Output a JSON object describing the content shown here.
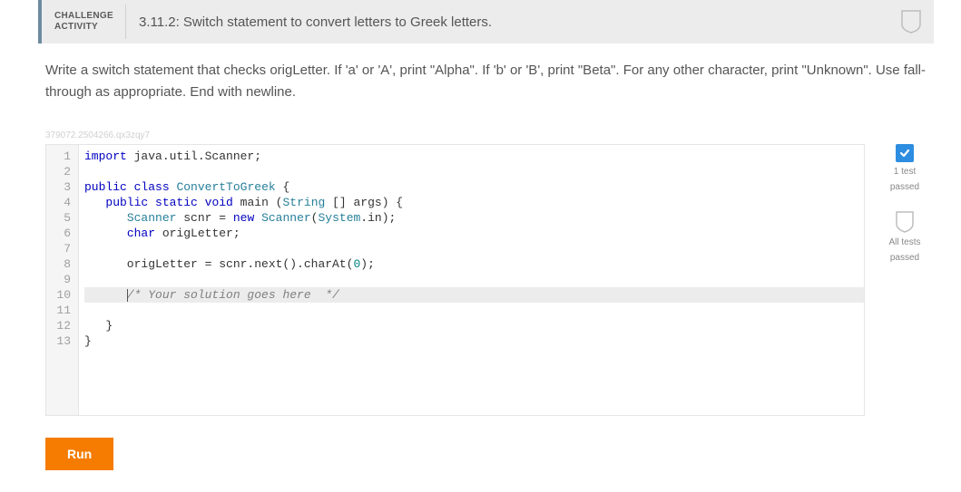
{
  "header": {
    "label_line1": "CHALLENGE",
    "label_line2": "ACTIVITY",
    "title": "3.11.2: Switch statement to convert letters to Greek letters."
  },
  "prompt": "Write a switch statement that checks origLetter. If 'a' or 'A', print \"Alpha\". If 'b' or 'B', print \"Beta\". For any other character, print \"Unknown\". Use fall-through as appropriate. End with newline.",
  "watermark": "379072.2504266.qx3zqy7",
  "code": {
    "line_numbers": [
      "1",
      "2",
      "3",
      "4",
      "5",
      "6",
      "7",
      "8",
      "9",
      "10",
      "11",
      "12",
      "13"
    ],
    "lines": [
      {
        "i": 1,
        "segs": [
          {
            "t": "import",
            "c": "kw"
          },
          {
            "t": " java.util.Scanner;",
            "c": ""
          }
        ]
      },
      {
        "i": 2,
        "segs": []
      },
      {
        "i": 3,
        "segs": [
          {
            "t": "public",
            "c": "kw"
          },
          {
            "t": " ",
            "c": ""
          },
          {
            "t": "class",
            "c": "kw"
          },
          {
            "t": " ",
            "c": ""
          },
          {
            "t": "ConvertToGreek",
            "c": "cls"
          },
          {
            "t": " {",
            "c": ""
          }
        ]
      },
      {
        "i": 4,
        "segs": [
          {
            "t": "   ",
            "c": ""
          },
          {
            "t": "public",
            "c": "kw"
          },
          {
            "t": " ",
            "c": ""
          },
          {
            "t": "static",
            "c": "kw"
          },
          {
            "t": " ",
            "c": ""
          },
          {
            "t": "void",
            "c": "kw"
          },
          {
            "t": " main (",
            "c": ""
          },
          {
            "t": "String",
            "c": "type"
          },
          {
            "t": " [] args) {",
            "c": ""
          }
        ]
      },
      {
        "i": 5,
        "segs": [
          {
            "t": "      ",
            "c": ""
          },
          {
            "t": "Scanner",
            "c": "type"
          },
          {
            "t": " scnr = ",
            "c": ""
          },
          {
            "t": "new",
            "c": "kw"
          },
          {
            "t": " ",
            "c": ""
          },
          {
            "t": "Scanner",
            "c": "type"
          },
          {
            "t": "(",
            "c": ""
          },
          {
            "t": "System",
            "c": "type"
          },
          {
            "t": ".in);",
            "c": ""
          }
        ]
      },
      {
        "i": 6,
        "segs": [
          {
            "t": "      ",
            "c": ""
          },
          {
            "t": "char",
            "c": "kw"
          },
          {
            "t": " origLetter;",
            "c": ""
          }
        ]
      },
      {
        "i": 7,
        "segs": []
      },
      {
        "i": 8,
        "segs": [
          {
            "t": "      origLetter = scnr.next().charAt(",
            "c": ""
          },
          {
            "t": "0",
            "c": "num"
          },
          {
            "t": ");",
            "c": ""
          }
        ]
      },
      {
        "i": 9,
        "segs": []
      },
      {
        "i": 10,
        "hl": true,
        "segs": [
          {
            "t": "      ",
            "c": ""
          },
          {
            "cursor": true
          },
          {
            "t": "/* Your solution goes here  */",
            "c": "cmt"
          }
        ]
      },
      {
        "i": 11,
        "segs": []
      },
      {
        "i": 12,
        "segs": [
          {
            "t": "   }",
            "c": ""
          }
        ]
      },
      {
        "i": 13,
        "segs": [
          {
            "t": "}",
            "c": ""
          }
        ]
      }
    ]
  },
  "status": {
    "test1_line1": "1 test",
    "test1_line2": "passed",
    "test2_line1": "All tests",
    "test2_line2": "passed"
  },
  "buttons": {
    "run": "Run"
  },
  "colors": {
    "accent": "#f57c00",
    "check": "#2d8de0",
    "header_border": "#6c8b9f"
  }
}
